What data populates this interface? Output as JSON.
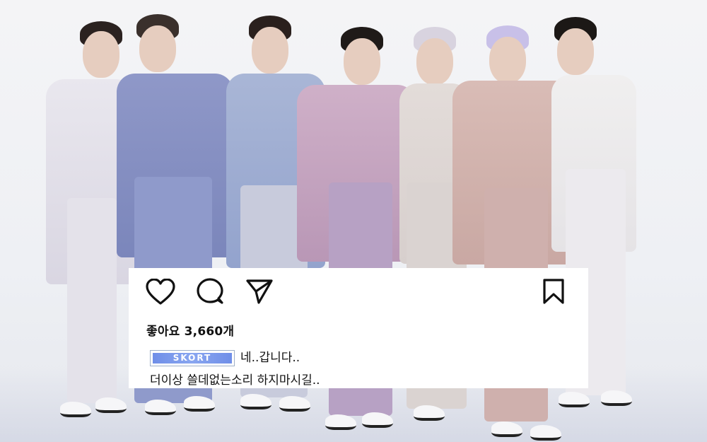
{
  "post": {
    "likes_text": "좋아요 3,660개",
    "username": "SKORT",
    "caption_line1": "네..갑니다..",
    "caption_line2": "더이상 쓸데없는소리 하지마시길.."
  },
  "icons": {
    "like": "heart-icon",
    "comment": "comment-icon",
    "share": "send-icon",
    "save": "bookmark-icon"
  },
  "colors": {
    "card_background": "#ffffff",
    "text": "#111111",
    "username_tag": "#7a98ec"
  }
}
